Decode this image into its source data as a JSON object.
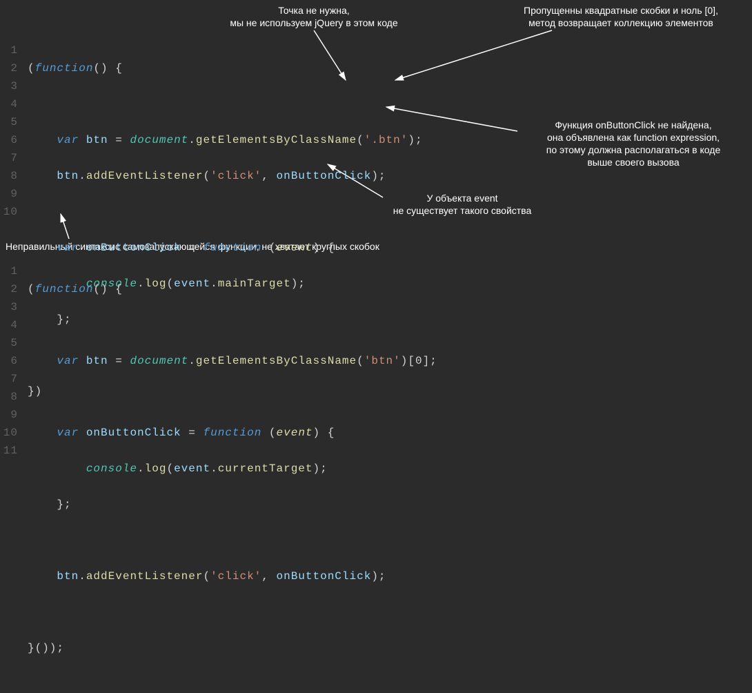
{
  "annotations": {
    "dot": {
      "line1": "Точка не нужна,",
      "line2": "мы не используем jQuery в этом коде"
    },
    "brackets": {
      "line1": "Пропущенны квадратные скобки и ноль [0],",
      "line2": "метод возвращает коллекцию элементов"
    },
    "onbtn": {
      "line1": "Функция onButtonClick не найдена,",
      "line2": "она объявлена как function expression,",
      "line3": "по этому должна располагаться в коде",
      "line4": "выше своего вызова"
    },
    "event": {
      "line1": "У объекта event",
      "line2": "не существует такого свойства"
    },
    "iife": "Неправильный синтаксис самозапускающейся функции, не хватает круглых скобок"
  },
  "code1": {
    "lines": [
      "1",
      "2",
      "3",
      "4",
      "5",
      "6",
      "7",
      "8",
      "9",
      "10"
    ],
    "kw_function": "function",
    "kw_var": "var",
    "id_btn": "btn",
    "obj_document": "document",
    "fn_getByClass": "getElementsByClassName",
    "str_btnDot": "'.btn'",
    "fn_addEvt": "addEventListener",
    "str_click": "'click'",
    "id_onBtn": "onButtonClick",
    "obj_console": "console",
    "fn_log": "log",
    "id_event": "event",
    "fn_mainTarget": "mainTarget"
  },
  "code2": {
    "lines": [
      "1",
      "2",
      "3",
      "4",
      "5",
      "6",
      "7",
      "8",
      "9",
      "10",
      "11"
    ],
    "kw_function": "function",
    "kw_var": "var",
    "id_btn": "btn",
    "obj_document": "document",
    "fn_getByClass": "getElementsByClassName",
    "str_btn": "'btn'",
    "idx0": "0",
    "id_onBtn": "onButtonClick",
    "id_event": "event",
    "obj_console": "console",
    "fn_log": "log",
    "fn_curTarget": "currentTarget",
    "fn_addEvt": "addEventListener",
    "str_click": "'click'"
  }
}
